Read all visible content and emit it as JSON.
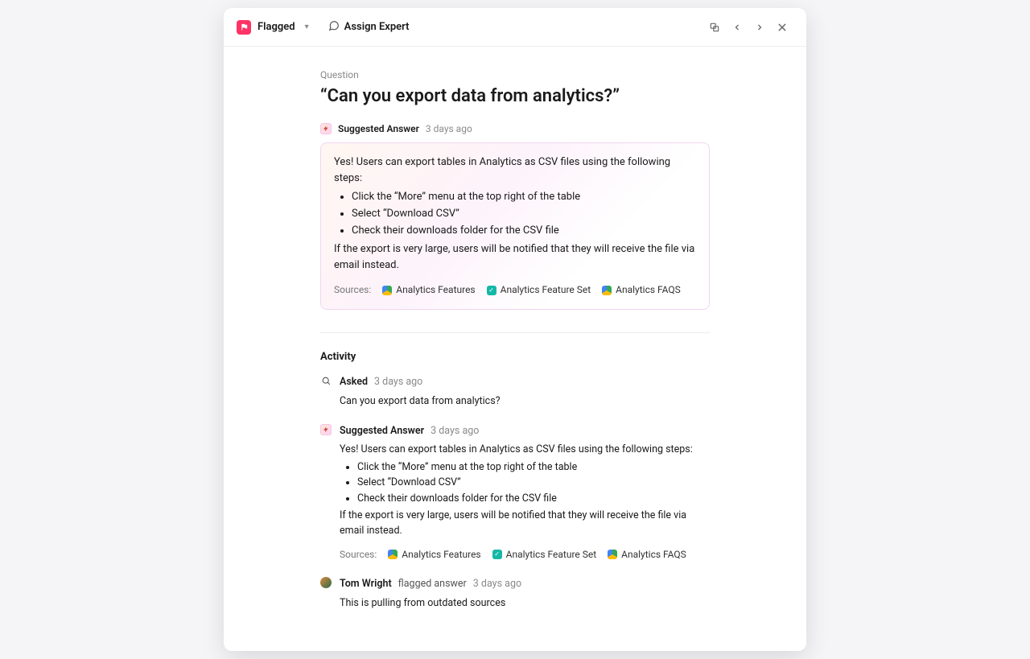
{
  "topbar": {
    "status_label": "Flagged",
    "assign_label": "Assign Expert"
  },
  "question": {
    "eyebrow": "Question",
    "headline": "“Can you export data from analytics?”"
  },
  "suggested_answer": {
    "label": "Suggested Answer",
    "timestamp": "3 days ago",
    "intro": "Yes! Users can export tables in Analytics as CSV files using the following steps:",
    "steps": [
      "Click the “More” menu at the top right of the table",
      "Select “Download CSV”",
      "Check their downloads folder for the CSV file"
    ],
    "outro": "If the export is very large, users will be notified that they will receive the file via email instead.",
    "sources_label": "Sources:",
    "sources": [
      {
        "name": "Analytics Features",
        "kind": "drive"
      },
      {
        "name": "Analytics Feature Set",
        "kind": "teal"
      },
      {
        "name": "Analytics FAQS",
        "kind": "drive"
      }
    ]
  },
  "activity": {
    "title": "Activity",
    "items": [
      {
        "kind": "asked",
        "label": "Asked",
        "timestamp": "3 days ago",
        "text": "Can you export data from analytics?"
      },
      {
        "kind": "suggested",
        "label": "Suggested Answer",
        "timestamp": "3 days ago",
        "intro": "Yes! Users can export tables in Analytics as CSV files using the following steps:",
        "steps": [
          "Click the “More” menu at the top right of the table",
          "Select “Download CSV”",
          "Check their downloads folder for the CSV file"
        ],
        "outro": "If the export is very large, users will be notified that they will receive the file via email instead.",
        "sources_label": "Sources:",
        "sources": [
          {
            "name": "Analytics Features",
            "kind": "drive"
          },
          {
            "name": "Analytics Feature Set",
            "kind": "teal"
          },
          {
            "name": "Analytics FAQS",
            "kind": "drive"
          }
        ]
      },
      {
        "kind": "flag",
        "user": "Tom Wright",
        "action": "flagged answer",
        "timestamp": "3 days ago",
        "text": "This is pulling from outdated sources"
      }
    ]
  }
}
